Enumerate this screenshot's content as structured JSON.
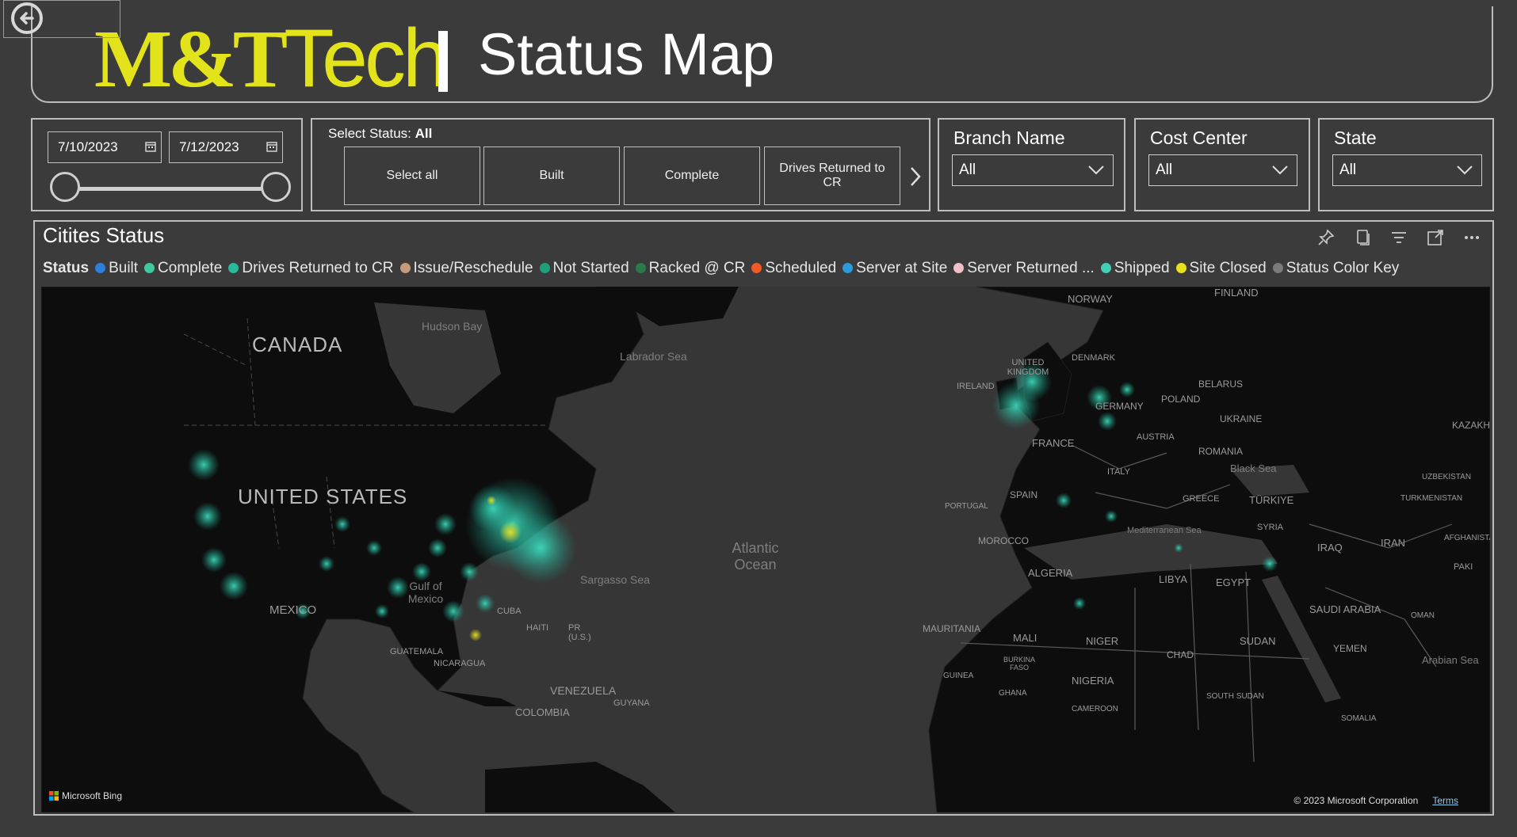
{
  "header": {
    "logo_part1": "M&T",
    "logo_part2": "Tech",
    "title": "Status Map"
  },
  "date_filter": {
    "start": "7/10/2023",
    "end": "7/12/2023"
  },
  "status_filter": {
    "title_label": "Select Status: ",
    "title_value": "All",
    "buttons": [
      "Select all",
      "Built",
      "Complete",
      "Drives Returned to CR"
    ]
  },
  "slicers": {
    "branch": {
      "title": "Branch Name",
      "value": "All"
    },
    "cost_center": {
      "title": "Cost Center",
      "value": "All"
    },
    "state": {
      "title": "State",
      "value": "All"
    }
  },
  "visual": {
    "title": "Citites Status",
    "legend_title": "Status",
    "legend": [
      {
        "label": "Built",
        "color": "#2f7ed8"
      },
      {
        "label": "Complete",
        "color": "#3fc9a0"
      },
      {
        "label": "Drives Returned to CR",
        "color": "#2ab89a"
      },
      {
        "label": "Issue/Reschedule",
        "color": "#c89a7a"
      },
      {
        "label": "Not Started",
        "color": "#1ea07a"
      },
      {
        "label": "Racked @ CR",
        "color": "#2a7a4a"
      },
      {
        "label": "Scheduled",
        "color": "#f05a28"
      },
      {
        "label": "Server at Site",
        "color": "#2a9ad8"
      },
      {
        "label": "Server Returned ...",
        "color": "#f0c0c8"
      },
      {
        "label": "Shipped",
        "color": "#40d0b8"
      },
      {
        "label": "Site Closed",
        "color": "#e8e020"
      },
      {
        "label": "Status Color Key",
        "color": "#7a7a7a"
      }
    ],
    "map_labels": [
      "CANADA",
      "UNITED STATES",
      "MEXICO",
      "Hudson Bay",
      "Labrador Sea",
      "Atlantic Ocean",
      "Sargasso Sea",
      "Gulf of Mexico",
      "CUBA",
      "HAITI",
      "PR (U.S.)",
      "GUATEMALA",
      "NICARAGUA",
      "VENEZUELA",
      "GUYANA",
      "COLOMBIA",
      "NORWAY",
      "FINLAND",
      "DENMARK",
      "UNITED KINGDOM",
      "IRELAND",
      "GERMANY",
      "POLAND",
      "BELARUS",
      "UKRAINE",
      "FRANCE",
      "AUSTRIA",
      "ROMANIA",
      "ITALY",
      "SPAIN",
      "PORTUGAL",
      "GREECE",
      "TÜRKIYE",
      "Black Sea",
      "Mediterranean Sea",
      "SYRIA",
      "IRAQ",
      "IRAN",
      "KAZAKH",
      "UZBEKISTAN",
      "TURKMENISTAN",
      "AFGHANISTAN",
      "PAKI",
      "MOROCCO",
      "ALGERIA",
      "LIBYA",
      "EGYPT",
      "SAUDI ARABIA",
      "OMAN",
      "YEMEN",
      "Arabian Sea",
      "MAURITANIA",
      "MALI",
      "NIGER",
      "CHAD",
      "SUDAN",
      "BURKINA FASO",
      "GUINEA",
      "GHANA",
      "NIGERIA",
      "CAMEROON",
      "SOUTH SUDAN",
      "SOMALIA"
    ],
    "bing_label": "Microsoft Bing",
    "copyright": "© 2023 Microsoft Corporation",
    "terms": "Terms"
  }
}
